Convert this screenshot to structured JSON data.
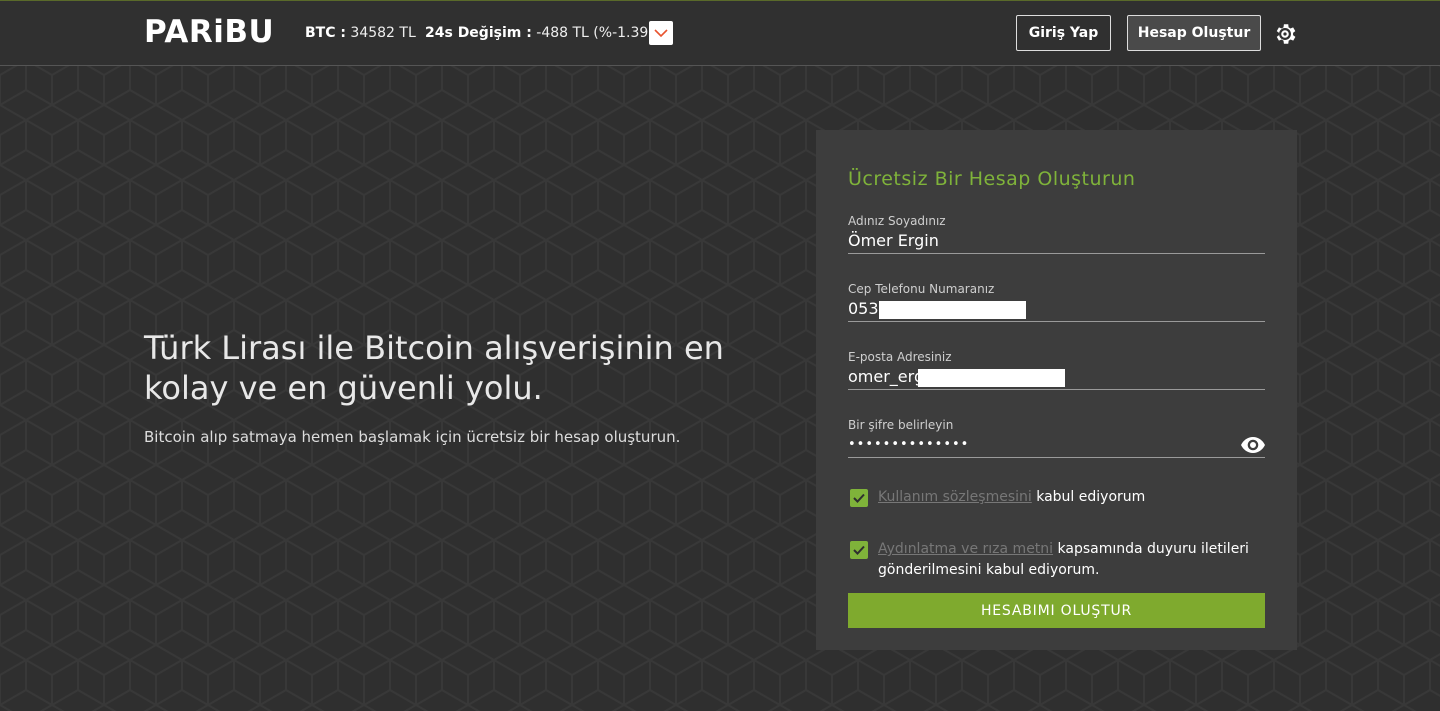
{
  "header": {
    "logo": "PARiBU",
    "btc_label": "BTC :",
    "btc_value": " 34582 TL",
    "change_label": "24s Değişim :",
    "change_value": " -488 TL (%-1.39)",
    "change_icon": "chevron-down-icon",
    "login_label": "Giriş Yap",
    "signup_label": "Hesap Oluştur",
    "settings_icon": "gear-icon"
  },
  "hero": {
    "title": "Türk Lirası ile Bitcoin alışverişinin en kolay ve en güvenli yolu.",
    "subtitle": "Bitcoin alıp satmaya hemen başlamak için ücretsiz bir hesap oluşturun."
  },
  "form": {
    "title": "Ücretsiz Bir Hesap Oluşturun",
    "name": {
      "label": "Adınız Soyadınız",
      "value": "Ömer Ergin"
    },
    "phone": {
      "label": "Cep Telefonu Numaranız",
      "value": "053"
    },
    "email": {
      "label": "E-posta Adresiniz",
      "value": "omer_erg"
    },
    "password": {
      "label": "Bir şifre belirleyin",
      "value": "••••••••••••••"
    },
    "terms": {
      "link": "Kullanım sözleşmesini",
      "text": " kabul ediyorum"
    },
    "consent": {
      "link": "Aydınlatma ve rıza metni",
      "text": " kapsamında duyuru iletileri gönderilmesini kabul ediyorum."
    },
    "submit_label": "HESABIMI OLUŞTUR"
  },
  "colors": {
    "accent": "#7fb33a",
    "button": "#7faa2e",
    "card": "#3d3d3d",
    "bg": "#2f2f2f"
  }
}
